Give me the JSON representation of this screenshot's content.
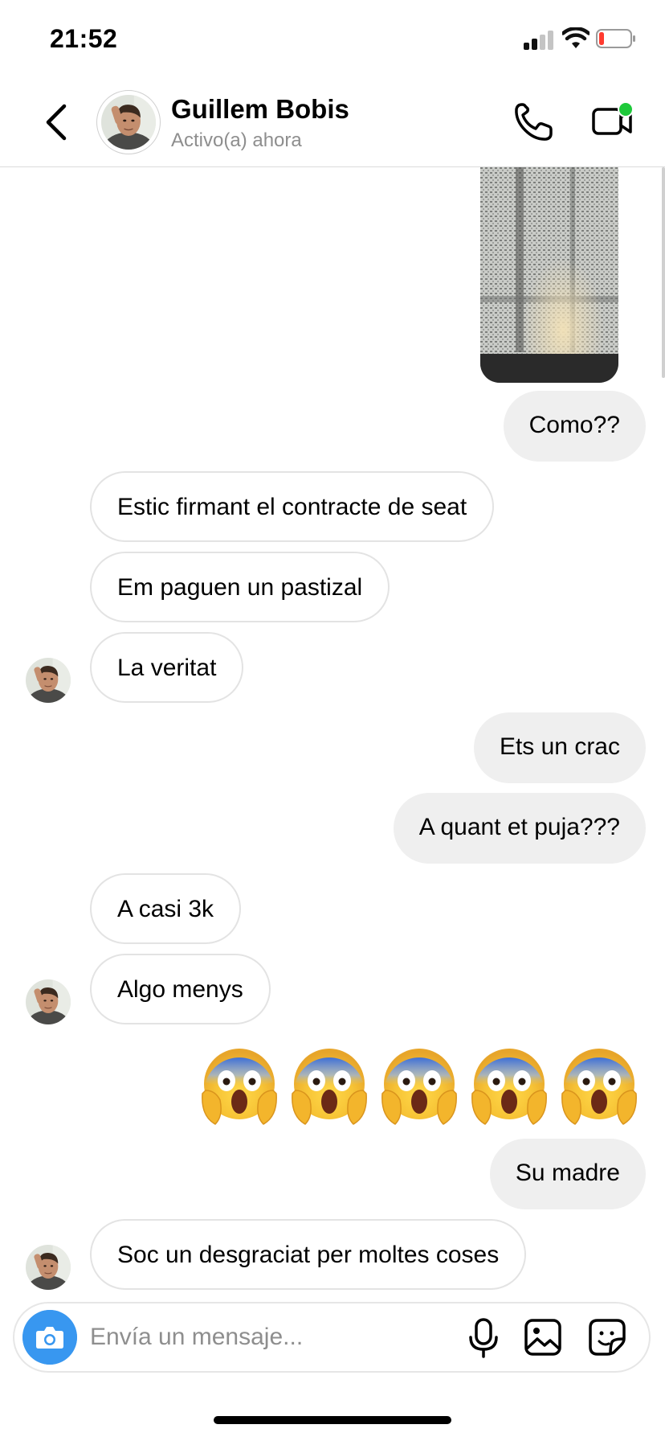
{
  "status_bar": {
    "time": "21:52",
    "battery_color": "#ff3b30"
  },
  "header": {
    "name": "Guillem Bobis",
    "status": "Activo(a) ahora",
    "online_color": "#1ec93a"
  },
  "messages": [
    {
      "side": "outgoing",
      "text": "Como??"
    },
    {
      "side": "incoming",
      "text": "Estic firmant el contracte de seat"
    },
    {
      "side": "incoming",
      "text": "Em paguen un pastizal"
    },
    {
      "side": "incoming",
      "text": "La veritat"
    },
    {
      "side": "outgoing",
      "text": "Ets un crac"
    },
    {
      "side": "outgoing",
      "text": "A quant et puja???"
    },
    {
      "side": "incoming",
      "text": "A casi 3k"
    },
    {
      "side": "incoming",
      "text": "Algo menys"
    },
    {
      "side": "outgoing",
      "text": "😱😱😱😱😱"
    },
    {
      "side": "outgoing",
      "text": "Su madre"
    },
    {
      "side": "incoming",
      "text": "Soc un desgraciat per moltes coses"
    }
  ],
  "composer": {
    "placeholder": "Envía un mensaje..."
  },
  "colors": {
    "accent": "#3897f0",
    "outgoing_bubble": "#efefef",
    "incoming_border": "#e3e3e3"
  }
}
